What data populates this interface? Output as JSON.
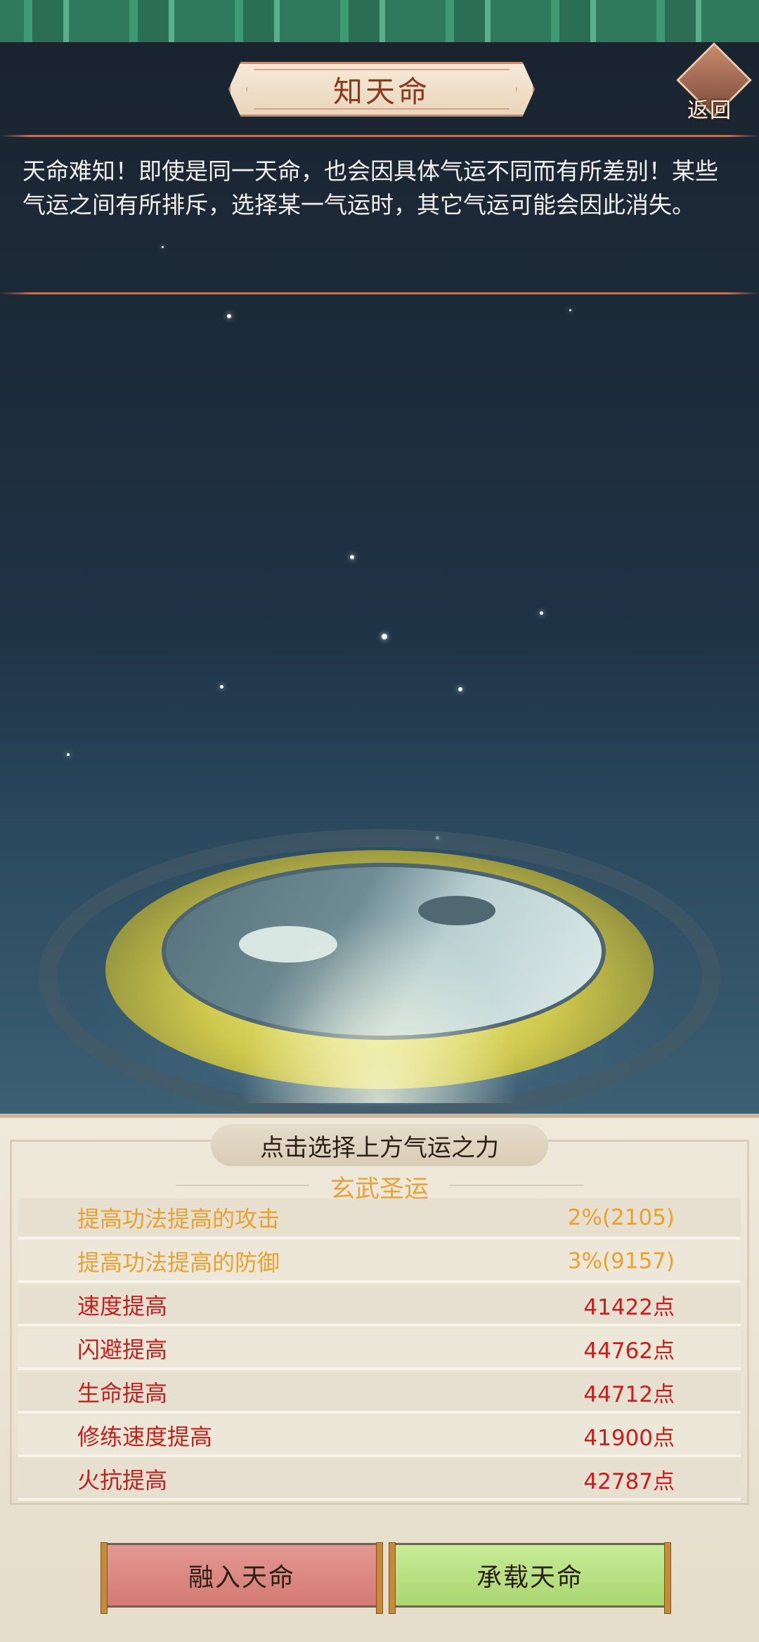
{
  "header": {
    "title": "知天命",
    "back_label": "返回"
  },
  "description": "天命难知！即使是同一天命，也会因具体气运不同而有所差别！某些气运之间有所排斥，选择某一气运时，其它气运可能会因此消失。",
  "panel": {
    "header": "点击选择上方气运之力",
    "fortune_name": "玄武圣运",
    "attributes": [
      {
        "name": "提高功法提高的攻击",
        "value": "2%(2105)",
        "color": "#e7a230"
      },
      {
        "name": "提高功法提高的防御",
        "value": "3%(9157)",
        "color": "#e7a230"
      },
      {
        "name": "速度提高",
        "value": "41422点",
        "color": "#c3211e"
      },
      {
        "name": "闪避提高",
        "value": "44762点",
        "color": "#c3211e"
      },
      {
        "name": "生命提高",
        "value": "44712点",
        "color": "#c3211e"
      },
      {
        "name": "修练速度提高",
        "value": "41900点",
        "color": "#c3211e"
      },
      {
        "name": "火抗提高",
        "value": "42787点",
        "color": "#c3211e"
      }
    ]
  },
  "buttons": {
    "merge": "融入天命",
    "carry": "承载天命"
  }
}
